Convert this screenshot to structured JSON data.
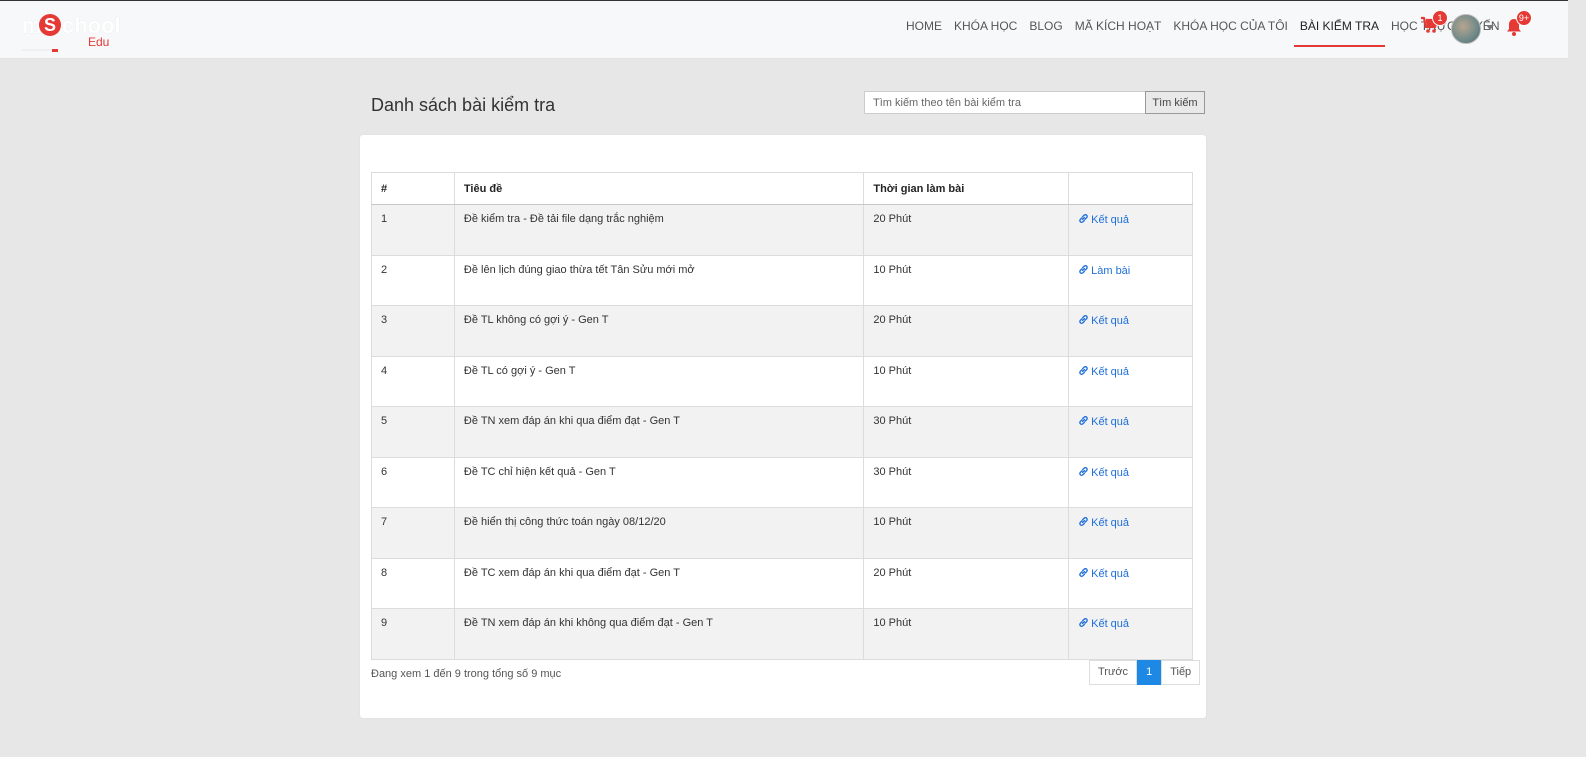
{
  "brand": {
    "logo_text": "mSchool",
    "logo_letter": "S",
    "logo_m": "m",
    "logo_rest": "chool",
    "logo_edu": "Edu"
  },
  "nav": {
    "items": [
      {
        "label": "HOME",
        "active": false
      },
      {
        "label": "KHÓA HỌC",
        "active": false
      },
      {
        "label": "BLOG",
        "active": false
      },
      {
        "label": "MÃ KÍCH HOẠT",
        "active": false
      },
      {
        "label": "KHÓA HỌC CỦA TÔI",
        "active": false
      },
      {
        "label": "BÀI KIỂM TRA",
        "active": true
      },
      {
        "label": "HỌC TRỰC TUYẾN",
        "active": false
      }
    ],
    "cart_count": "1",
    "notification_count": "9+",
    "accent_color": "#e53935"
  },
  "page": {
    "title": "Danh sách bài kiểm tra",
    "search_placeholder": "Tìm kiếm theo tên bài kiểm tra",
    "search_button": "Tìm kiếm"
  },
  "table": {
    "headers": [
      "#",
      "Tiêu đề",
      "Thời gian làm bài",
      ""
    ],
    "rows": [
      {
        "no": "1",
        "title": "Đề kiểm tra - Đề tải file dạng trắc nghiệm",
        "time": "20 Phút",
        "action": "Kết quả"
      },
      {
        "no": "2",
        "title": "Đề lên lịch đúng giao thừa tết Tân Sửu mới mở",
        "time": "10 Phút",
        "action": "Làm bài"
      },
      {
        "no": "3",
        "title": "Đề TL không có gợi ý - Gen T",
        "time": "20 Phút",
        "action": "Kết quả"
      },
      {
        "no": "4",
        "title": "Đề TL có gợi ý - Gen T",
        "time": "10 Phút",
        "action": "Kết quả"
      },
      {
        "no": "5",
        "title": "Đề TN xem đáp án khi qua điểm đạt - Gen T",
        "time": "30 Phút",
        "action": "Kết quả"
      },
      {
        "no": "6",
        "title": "Đề TC chỉ hiện kết quả - Gen T",
        "time": "30 Phút",
        "action": "Kết quả"
      },
      {
        "no": "7",
        "title": "Đề hiển thị công thức toán ngày 08/12/20",
        "time": "10 Phút",
        "action": "Kết quả"
      },
      {
        "no": "8",
        "title": "Đề TC xem đáp án khi qua điểm đạt - Gen T",
        "time": "20 Phút",
        "action": "Kết quả"
      },
      {
        "no": "9",
        "title": "Đề TN xem đáp án khi không qua điểm đạt - Gen T",
        "time": "10 Phút",
        "action": "Kết quả"
      }
    ],
    "info": "Đang xem 1 đến 9 trong tổng số 9 mục"
  },
  "pagination": {
    "prev": "Trước",
    "current": "1",
    "next": "Tiếp"
  },
  "colors": {
    "link": "#1e6fd9",
    "page_active": "#1e88e5",
    "background": "#e7e7e7"
  }
}
